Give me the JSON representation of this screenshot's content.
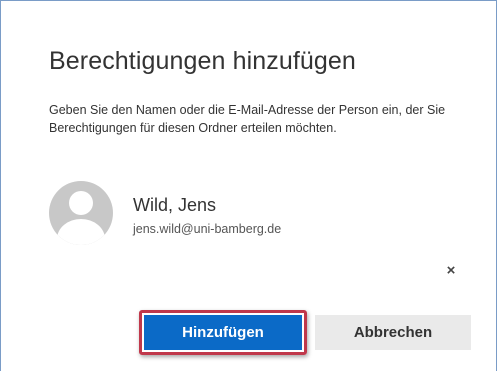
{
  "dialog": {
    "title": "Berechtigungen hinzufügen",
    "instructions": "Geben Sie den Namen oder die E-Mail-Adresse der Person ein, der Sie Berechtigungen für diesen Ordner erteilen möchten."
  },
  "person": {
    "name": "Wild, Jens",
    "email": "jens.wild@uni-bamberg.de",
    "remove_symbol": "×",
    "avatar_icon": "person-placeholder-icon"
  },
  "buttons": {
    "add_label": "Hinzufügen",
    "cancel_label": "Abbrechen"
  },
  "colors": {
    "primary": "#0b6ac7",
    "highlight": "#c0384b",
    "secondary_bg": "#eaeaea"
  }
}
